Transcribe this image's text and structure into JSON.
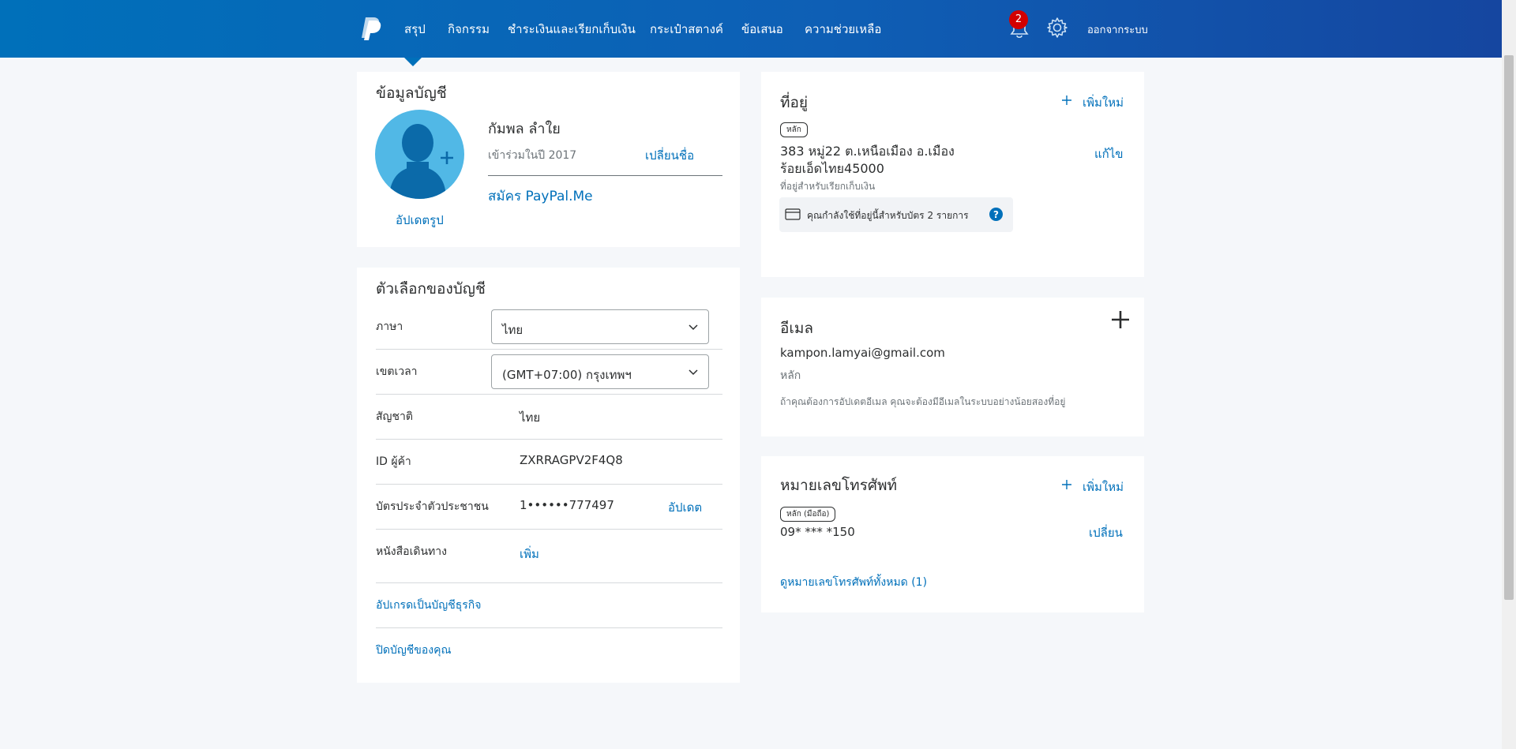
{
  "nav": {
    "items": [
      "สรุป",
      "กิจกรรม",
      "ชำระเงินและเรียกเก็บเงิน",
      "กระเป๋าสตางค์",
      "ข้อเสนอ",
      "ความช่วยเหลือ"
    ],
    "notification_count": "2",
    "logout_label": "ออกจากระบบ"
  },
  "profile": {
    "title": "ข้อมูลบัญชี",
    "name": "กัมพล ลำใย",
    "joined": "เข้าร่วมในปี 2017",
    "change_name": "เปลี่ยนชื่อ",
    "paypal_me": "สมัคร PayPal.Me",
    "update_photo": "อัปเดตรูป"
  },
  "options": {
    "title": "ตัวเลือกของบัญชี",
    "language_label": "ภาษา",
    "language_value": "ไทย",
    "timezone_label": "เขตเวลา",
    "timezone_value": "(GMT+07:00) กรุงเทพฯ",
    "nationality_label": "สัญชาติ",
    "nationality_value": "ไทย",
    "merchant_id_label": "ID ผู้ค้า",
    "merchant_id_value": "ZXRRAGPV2F4Q8",
    "national_id_label": "บัตรประจำตัวประชาชน",
    "national_id_value": "1••••••777497",
    "national_id_action": "อัปเดต",
    "passport_label": "หนังสือเดินทาง",
    "passport_action": "เพิ่ม",
    "upgrade_business": "อัปเกรดเป็นบัญชีธุรกิจ",
    "close_account": "ปิดบัญชีของคุณ"
  },
  "address": {
    "title": "ที่อยู่",
    "add_new": "เพิ่มใหม่",
    "tag": "หลัก",
    "line1": "383 หมู่22 ต.เหนือเมือง อ.เมือง",
    "line2": "ร้อยเอ็ดไทย45000",
    "edit": "แก้ไข",
    "billing_note": "ที่อยู่สำหรับเรียกเก็บเงิน",
    "cards_note": "คุณกำลังใช้ที่อยู่นี้สำหรับบัตร 2 รายการ"
  },
  "email": {
    "title": "อีเมล",
    "address": "kampon.lamyai@gmail.com",
    "tag": "หลัก",
    "note": "ถ้าคุณต้องการอัปเดตอีเมล คุณจะต้องมีอีเมลในระบบอย่างน้อยสองที่อยู่"
  },
  "phone": {
    "title": "หมายเลขโทรศัพท์",
    "add_new": "เพิ่มใหม่",
    "tag": "หลัก (มือถือ)",
    "number": "09* *** *150",
    "change": "เปลี่ยน",
    "view_all": "ดูหมายเลขโทรศัพท์ทั้งหมด (1)"
  },
  "colors": {
    "header_start": "#0070ba",
    "header_end": "#1546a0",
    "link": "#0070ba",
    "badge": "#d20000",
    "avatar": "#51b8e6"
  }
}
